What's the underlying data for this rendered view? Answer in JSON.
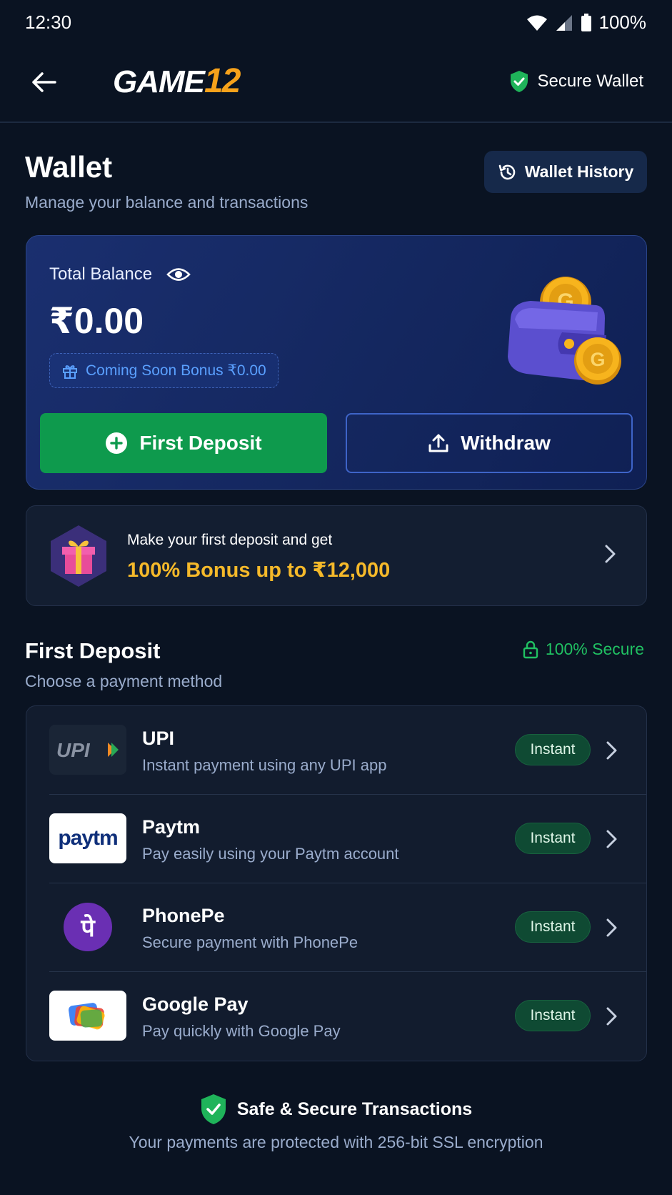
{
  "status_bar": {
    "time": "12:30",
    "battery": "100%"
  },
  "header": {
    "logo_text": "GAME",
    "logo_number": "12",
    "secure_label": "Secure Wallet"
  },
  "page": {
    "title": "Wallet",
    "subtitle": "Manage your balance and transactions",
    "history_label": "Wallet History"
  },
  "balance": {
    "label": "Total Balance",
    "value": "₹0.00",
    "bonus_text": "Coming Soon Bonus ₹0.00",
    "deposit_label": "First Deposit",
    "withdraw_label": "Withdraw"
  },
  "promo": {
    "line1": "Make your first deposit and get",
    "line2": "100% Bonus up to ₹12,000"
  },
  "deposit_section": {
    "title": "First Deposit",
    "subtitle": "Choose a payment method",
    "secure_label": "100% Secure",
    "methods": [
      {
        "name": "UPI",
        "description": "Instant payment using any UPI app",
        "badge": "Instant",
        "logo_text": "UPI"
      },
      {
        "name": "Paytm",
        "description": "Pay easily using your Paytm account",
        "badge": "Instant",
        "logo_text": "paytm"
      },
      {
        "name": "PhonePe",
        "description": "Secure payment with PhonePe",
        "badge": "Instant",
        "logo_text": "पे"
      },
      {
        "name": "Google Pay",
        "description": "Pay quickly with Google Pay",
        "badge": "Instant",
        "logo_text": ""
      }
    ]
  },
  "footer": {
    "title": "Safe & Secure Transactions",
    "subtitle": "Your payments are protected with 256-bit SSL encryption"
  },
  "colors": {
    "background": "#0a1322",
    "accent_green": "#0e9a4d",
    "bonus_yellow": "#f5b92a",
    "logo_orange": "#f7a21b",
    "card_blue": "#1a2f6f"
  }
}
